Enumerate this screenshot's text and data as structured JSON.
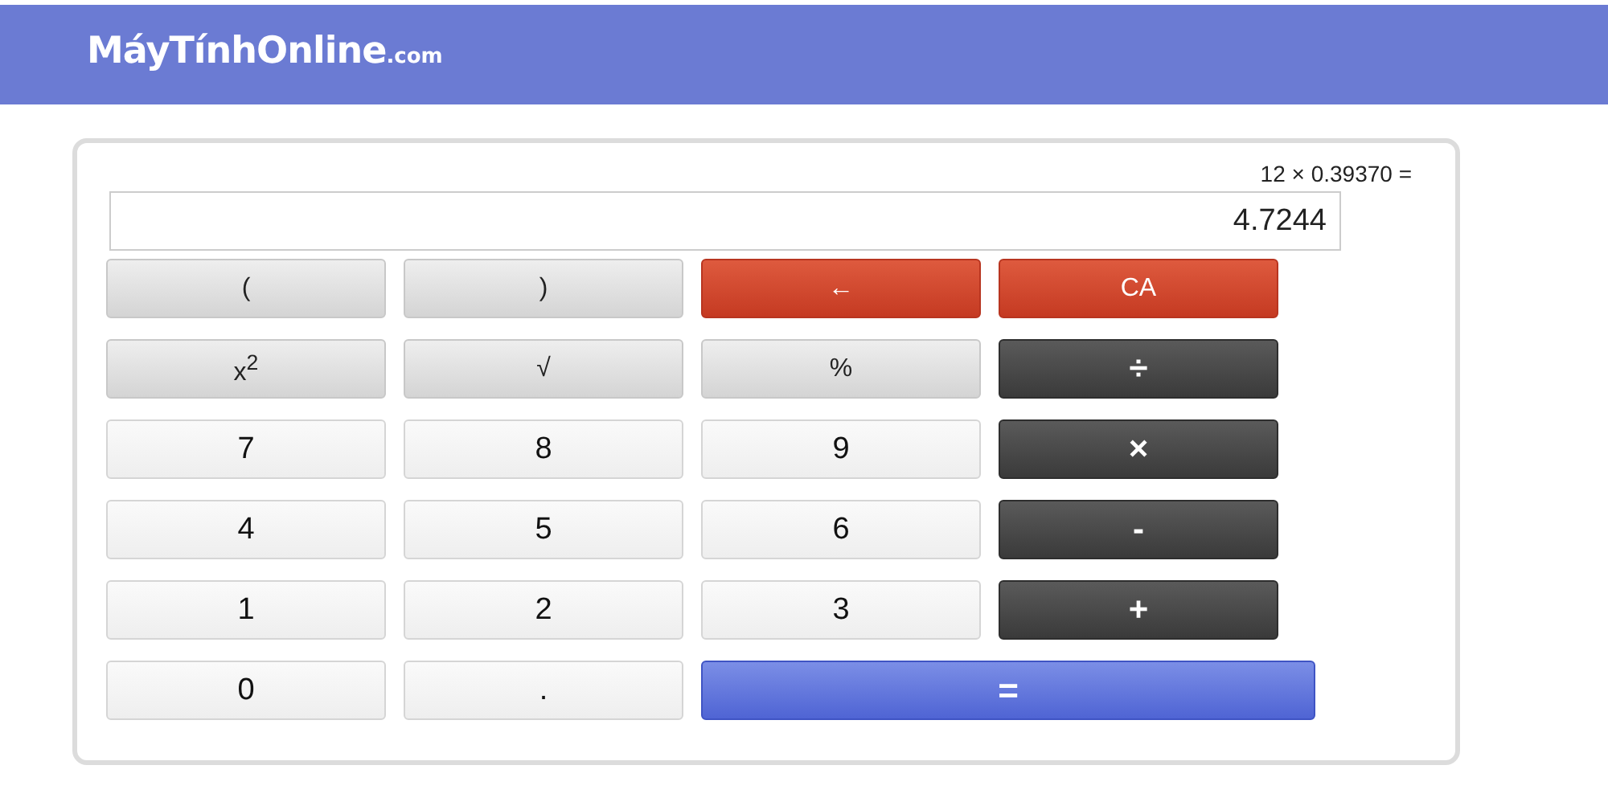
{
  "header": {
    "logo": "MáyTínhOnline",
    "logo_suffix": ".com"
  },
  "calculator": {
    "expression": "12 × 0.39370 =",
    "display": "4.7244",
    "keys": [
      {
        "label": "(",
        "kind": "gray"
      },
      {
        "label": ")",
        "kind": "gray"
      },
      {
        "label": "←",
        "kind": "red"
      },
      {
        "label": "CA",
        "kind": "red"
      },
      {
        "label": "x$^{2}$",
        "kind": "gray"
      },
      {
        "label": "√",
        "kind": "gray"
      },
      {
        "label": "%",
        "kind": "gray"
      },
      {
        "label": "÷",
        "kind": "dark"
      },
      {
        "label": "7",
        "kind": "light"
      },
      {
        "label": "8",
        "kind": "light"
      },
      {
        "label": "9",
        "kind": "light"
      },
      {
        "label": "×",
        "kind": "dark"
      },
      {
        "label": "4",
        "kind": "light"
      },
      {
        "label": "5",
        "kind": "light"
      },
      {
        "label": "6",
        "kind": "light"
      },
      {
        "label": "-",
        "kind": "dark"
      },
      {
        "label": "1",
        "kind": "light"
      },
      {
        "label": "2",
        "kind": "light"
      },
      {
        "label": "3",
        "kind": "light"
      },
      {
        "label": "+",
        "kind": "dark"
      },
      {
        "label": "0",
        "kind": "light"
      },
      {
        "label": ".",
        "kind": "light"
      },
      {
        "label": "=",
        "kind": "blue"
      }
    ]
  }
}
